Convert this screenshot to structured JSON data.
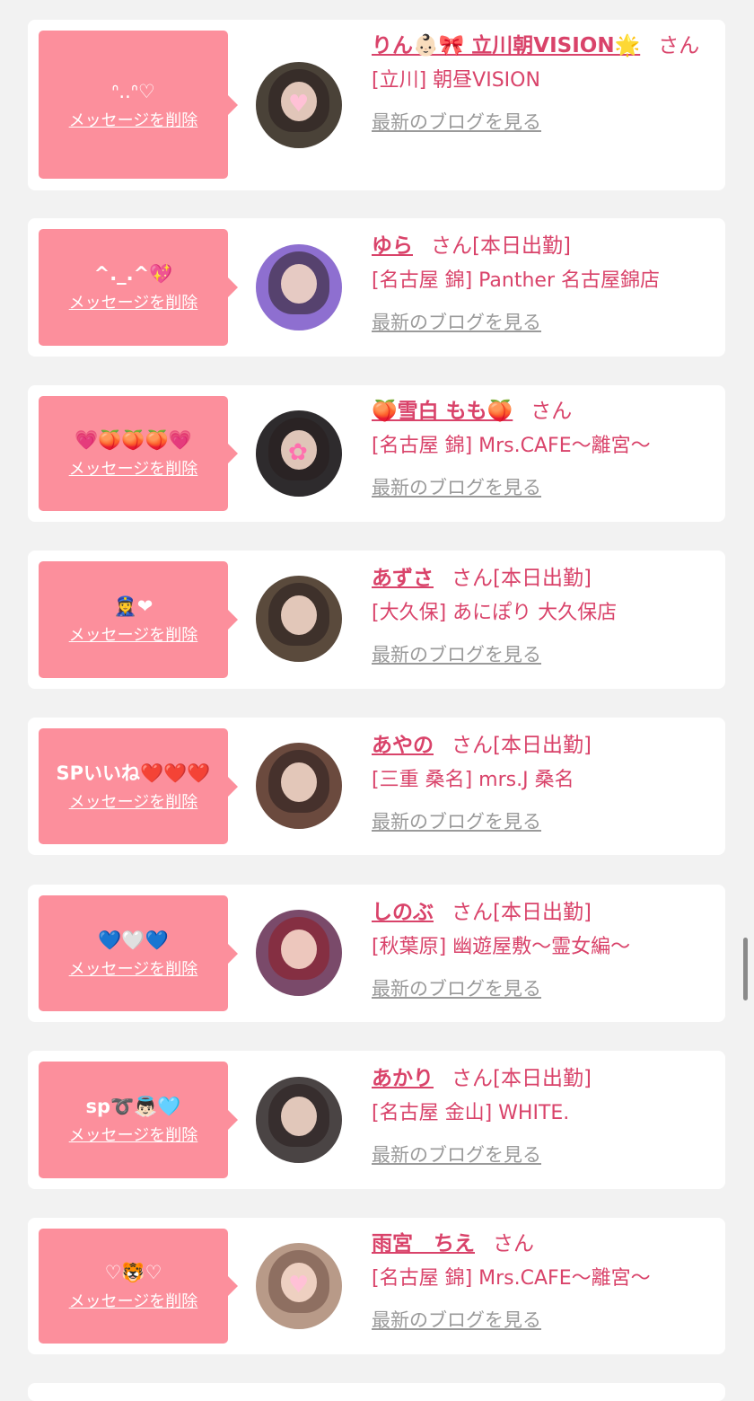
{
  "delete_label": "メッセージを削除",
  "blog_label": "最新のブログを見る",
  "colors": {
    "accent": "#d9436a",
    "bubble": "#fc8f9c",
    "link_gray": "#9a9a9a"
  },
  "items": [
    {
      "message": "ᐢ..ᐢ♡",
      "name": "りん👶🏻🎀 立川朝VISION🌟",
      "suffix": "さん",
      "shop": "[立川] 朝昼VISION"
    },
    {
      "message": "^._.^💖",
      "name": "ゆら",
      "suffix": "さん[本日出勤]",
      "shop": "[名古屋 錦] Panther 名古屋錦店"
    },
    {
      "message": "💗🍑🍑🍑💗",
      "name": "🍑雪白 もも🍑",
      "suffix": "さん",
      "shop": "[名古屋 錦] Mrs.CAFE〜離宮〜"
    },
    {
      "message": "👮‍♀️❤",
      "name": "あずさ",
      "suffix": "さん[本日出勤]",
      "shop": "[大久保] あにぽり 大久保店"
    },
    {
      "message": "SPいいね❤️❤️❤️",
      "name": "あやの",
      "suffix": "さん[本日出勤]",
      "shop": "[三重 桑名] mrs.J 桑名"
    },
    {
      "message": "💙🤍💙",
      "name": "しのぶ",
      "suffix": "さん[本日出勤]",
      "shop": "[秋葉原] 幽遊屋敷〜霊女編〜"
    },
    {
      "message": "sp➰👼🏻🩵",
      "name": "あかり",
      "suffix": "さん[本日出勤]",
      "shop": "[名古屋 金山] WHITE."
    },
    {
      "message": "♡🐯♡",
      "name": "雨宮　ちえ",
      "suffix": "さん",
      "shop": "[名古屋 錦] Mrs.CAFE〜離宮〜"
    }
  ]
}
